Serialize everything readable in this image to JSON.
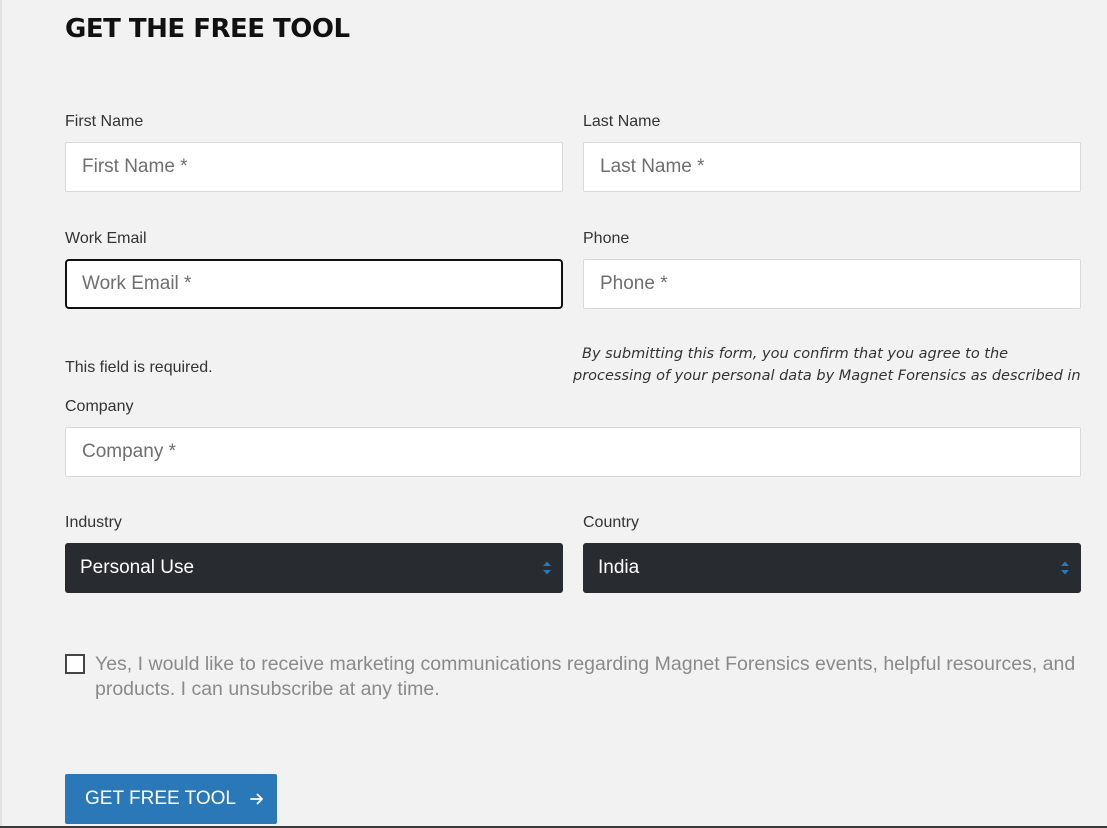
{
  "form": {
    "title": "GET THE FREE TOOL",
    "first_name": {
      "label": "First Name",
      "placeholder": "First Name *",
      "value": ""
    },
    "last_name": {
      "label": "Last Name",
      "placeholder": "Last Name *",
      "value": ""
    },
    "work_email": {
      "label": "Work Email",
      "placeholder": "Work Email *",
      "value": "",
      "error": "This field is required."
    },
    "phone": {
      "label": "Phone",
      "placeholder": "Phone *",
      "value": ""
    },
    "consent_text_line1": "By submitting this form, you confirm that you agree to the",
    "consent_text_line2": "processing of your personal data by Magnet Forensics as described in",
    "company": {
      "label": "Company",
      "placeholder": "Company *",
      "value": ""
    },
    "industry": {
      "label": "Industry",
      "selected": "Personal Use"
    },
    "country": {
      "label": "Country",
      "selected": "India"
    },
    "marketing_opt_in": {
      "label": "Yes, I would like to receive marketing communications regarding Magnet Forensics events, helpful resources, and products. I can unsubscribe at any time.",
      "checked": false
    },
    "submit_label": "GET FREE TOOL"
  },
  "icons": {
    "select_arrows": "chevron-up-down-icon",
    "submit_arrow": "arrow-right-icon"
  },
  "colors": {
    "page_background": "#f2f2f2",
    "select_background": "#282c30",
    "select_arrow_accent": "#2a78b7",
    "button_background": "#2a78b7",
    "placeholder_text": "#6f6f6f",
    "marketing_text": "#8a8a8a"
  }
}
